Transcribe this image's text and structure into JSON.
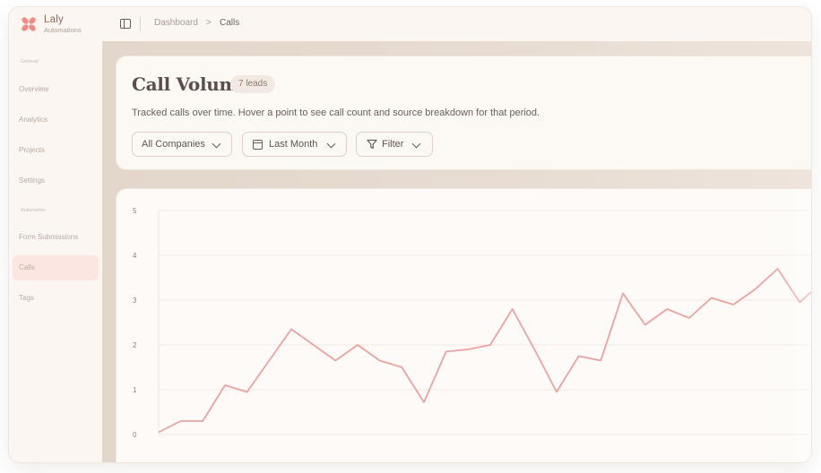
{
  "brand": {
    "name": "Laly",
    "subtitle": "Automations",
    "color": "#f08b86"
  },
  "sidebar": {
    "section_general": "General",
    "section_automation": "Automation",
    "items": [
      {
        "label": "Overview"
      },
      {
        "label": "Analytics"
      },
      {
        "label": "Projects"
      },
      {
        "label": "Settings"
      },
      {
        "label": "Form Submissions"
      },
      {
        "label": "Calls",
        "active": true
      },
      {
        "label": "Tags"
      }
    ]
  },
  "header": {
    "toggle_icon": "sidebar-toggle-icon",
    "breadcrumb": [
      "Dashboard",
      "Calls"
    ],
    "breadcrumb_separator": ">"
  },
  "page": {
    "title": "Call Volume",
    "badge": "7 leads",
    "description": "Tracked calls over time. Hover a point to see call count and source breakdown for that period."
  },
  "filters": {
    "company": {
      "label": "All Companies",
      "icon": "chevron-down-icon"
    },
    "period": {
      "label": "Last Month",
      "icon": "calendar-icon"
    },
    "filter": {
      "label": "Filter",
      "icon": "funnel-icon"
    }
  },
  "chart_data": {
    "type": "line",
    "y_ticks": [
      "5",
      "4",
      "3",
      "2",
      "1",
      "0"
    ],
    "ylim": [
      0,
      5
    ],
    "grid": true,
    "line_color": "#e9a3a0",
    "series": [
      {
        "values": [
          0.05,
          0.3,
          0.3,
          1.1,
          0.95,
          1.65,
          2.35,
          2.0,
          1.65,
          2.0,
          1.65,
          1.5,
          0.72,
          1.85,
          1.9,
          2.0,
          2.8,
          1.9,
          0.95,
          1.75,
          1.65,
          3.15,
          2.45,
          2.8,
          2.6,
          3.05,
          2.9,
          3.25,
          3.7,
          2.95,
          3.4
        ]
      }
    ]
  }
}
